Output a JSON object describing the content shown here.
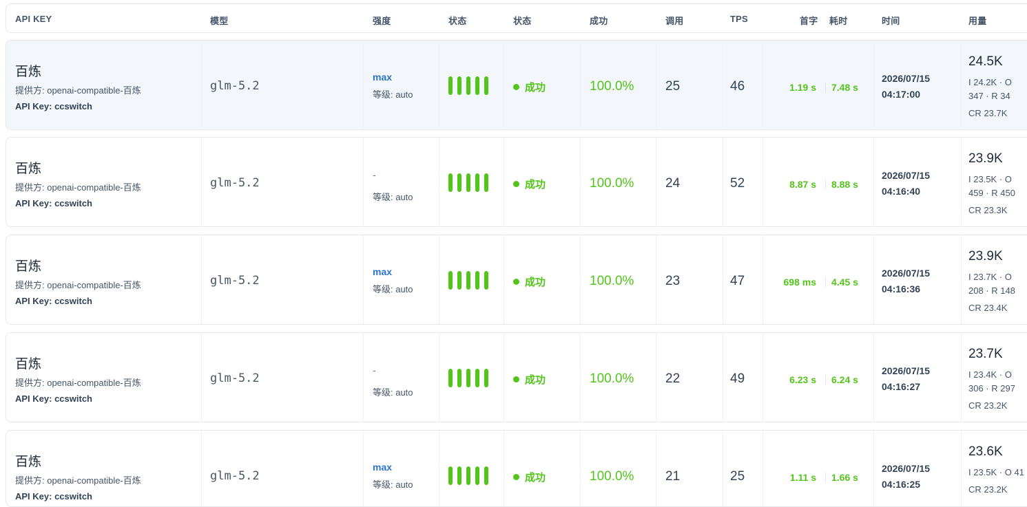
{
  "columns": {
    "api_key": "API KEY",
    "model": "模型",
    "intensity": "强度",
    "status1": "状态",
    "status2": "状态",
    "success": "成功",
    "calls": "调用",
    "tps": "TPS",
    "first_token": "首字",
    "duration": "耗时",
    "time": "时间",
    "usage": "用量"
  },
  "colors": {
    "success_green": "#52c41a",
    "intensity_blue": "#2b74c7",
    "highlight_row": "#f3f6fb"
  },
  "rows": [
    {
      "name": "百炼",
      "provider": "提供方: openai-compatible-百炼",
      "api_key": "API Key: ccswitch",
      "model": "glm-5.2",
      "intensity": "max",
      "level": "等级: auto",
      "status": "成功",
      "success_rate": "100.0%",
      "calls": "25",
      "tps": "46",
      "first_token": "1.19 s",
      "duration": "7.48 s",
      "date": "2026/07/15",
      "clock": "04:17:00",
      "usage_total": "24.5K",
      "usage_line1": "I 24.2K · O",
      "usage_line2": "347 · R 34",
      "usage_line3": "CR 23.7K"
    },
    {
      "name": "百炼",
      "provider": "提供方: openai-compatible-百炼",
      "api_key": "API Key: ccswitch",
      "model": "glm-5.2",
      "intensity": "-",
      "level": "等级: auto",
      "status": "成功",
      "success_rate": "100.0%",
      "calls": "24",
      "tps": "52",
      "first_token": "8.87 s",
      "duration": "8.88 s",
      "date": "2026/07/15",
      "clock": "04:16:40",
      "usage_total": "23.9K",
      "usage_line1": "I 23.5K · O",
      "usage_line2": "459 · R 450",
      "usage_line3": "CR 23.3K"
    },
    {
      "name": "百炼",
      "provider": "提供方: openai-compatible-百炼",
      "api_key": "API Key: ccswitch",
      "model": "glm-5.2",
      "intensity": "max",
      "level": "等级: auto",
      "status": "成功",
      "success_rate": "100.0%",
      "calls": "23",
      "tps": "47",
      "first_token": "698 ms",
      "duration": "4.45 s",
      "date": "2026/07/15",
      "clock": "04:16:36",
      "usage_total": "23.9K",
      "usage_line1": "I 23.7K · O",
      "usage_line2": "208 · R 148",
      "usage_line3": "CR 23.4K"
    },
    {
      "name": "百炼",
      "provider": "提供方: openai-compatible-百炼",
      "api_key": "API Key: ccswitch",
      "model": "glm-5.2",
      "intensity": "-",
      "level": "等级: auto",
      "status": "成功",
      "success_rate": "100.0%",
      "calls": "22",
      "tps": "49",
      "first_token": "6.23 s",
      "duration": "6.24 s",
      "date": "2026/07/15",
      "clock": "04:16:27",
      "usage_total": "23.7K",
      "usage_line1": "I 23.4K · O",
      "usage_line2": "306 · R 297",
      "usage_line3": "CR 23.2K"
    },
    {
      "name": "百炼",
      "provider": "提供方: openai-compatible-百炼",
      "api_key": "API Key: ccswitch",
      "model": "glm-5.2",
      "intensity": "max",
      "level": "等级: auto",
      "status": "成功",
      "success_rate": "100.0%",
      "calls": "21",
      "tps": "25",
      "first_token": "1.11 s",
      "duration": "1.66 s",
      "date": "2026/07/15",
      "clock": "04:16:25",
      "usage_total": "23.6K",
      "usage_line1": "I 23.5K · O 41",
      "usage_line2": "",
      "usage_line3": "CR 23.2K"
    }
  ]
}
